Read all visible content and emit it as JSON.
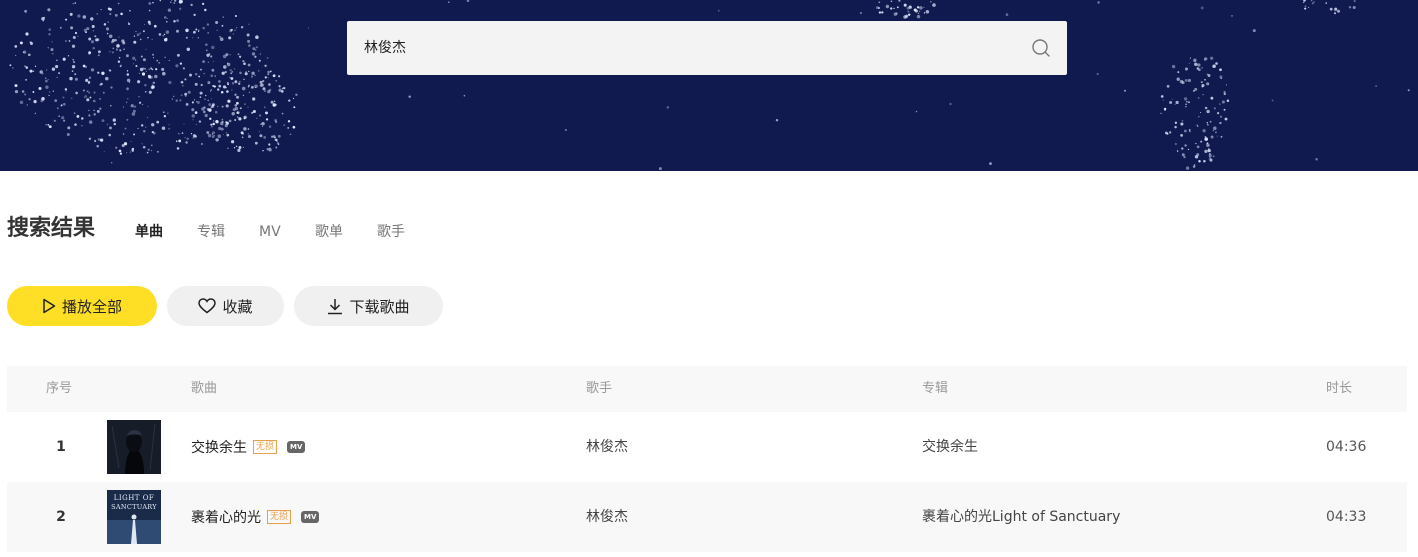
{
  "search": {
    "query": "林俊杰",
    "icon": "search-icon"
  },
  "results": {
    "title": "搜索结果",
    "tabs": [
      {
        "label": "单曲",
        "active": true
      },
      {
        "label": "专辑",
        "active": false
      },
      {
        "label": "MV",
        "active": false
      },
      {
        "label": "歌单",
        "active": false
      },
      {
        "label": "歌手",
        "active": false
      }
    ]
  },
  "actions": {
    "play_all": "播放全部",
    "favorite": "收藏",
    "download": "下载歌曲"
  },
  "table": {
    "headers": {
      "index": "序号",
      "song": "歌曲",
      "artist": "歌手",
      "album": "专辑",
      "duration": "时长"
    },
    "rows": [
      {
        "index": "1",
        "song": "交换余生",
        "lossless_tag": "无损",
        "mv_tag": "MV",
        "artist": "林俊杰",
        "album": "交换余生",
        "duration": "04:36"
      },
      {
        "index": "2",
        "song": "裹着心的光",
        "lossless_tag": "无损",
        "mv_tag": "MV",
        "artist": "林俊杰",
        "album": "裹着心的光Light of Sanctuary",
        "duration": "04:33",
        "cover_text": "LIGHT OF SANCTUARY"
      }
    ]
  },
  "colors": {
    "banner": "#111a4f",
    "accent": "#ffde26",
    "lossless": "#e8a14a"
  }
}
